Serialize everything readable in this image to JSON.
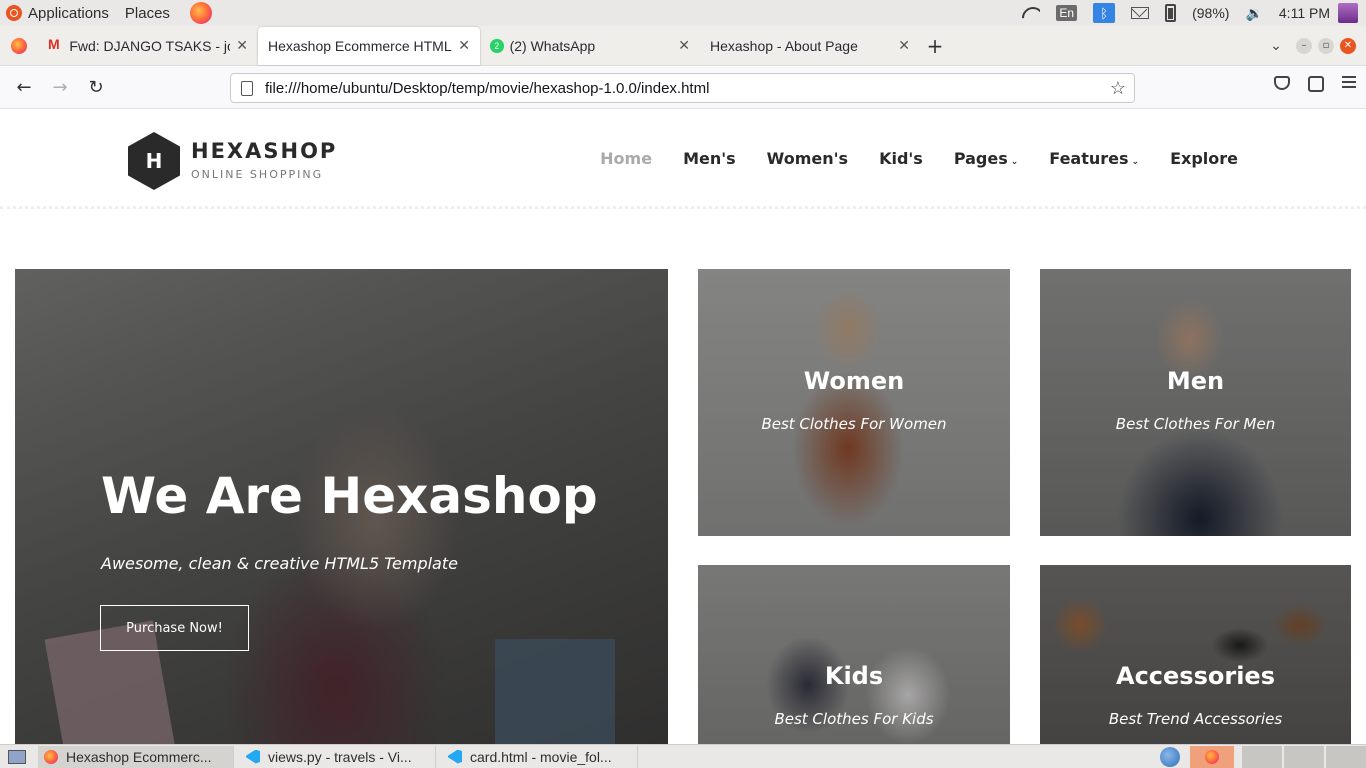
{
  "os_panel": {
    "applications_label": "Applications",
    "places_label": "Places",
    "lang": "En",
    "battery": "(98%)",
    "clock": "4:11 PM"
  },
  "browser": {
    "tabs": [
      {
        "title": "Fwd: DJANGO TSAKS - jo",
        "icon": "gmail-icon"
      },
      {
        "title": "Hexashop Ecommerce HTML",
        "icon": "none",
        "active": true
      },
      {
        "title": "(2) WhatsApp",
        "icon": "whatsapp-icon",
        "badge": "2"
      },
      {
        "title": "Hexashop - About Page",
        "icon": "none"
      }
    ],
    "url": "file:///home/ubuntu/Desktop/temp/movie/hexashop-1.0.0/index.html"
  },
  "site": {
    "logo_letter": "H",
    "logo_name": "HEXASHOP",
    "logo_tagline": "ONLINE SHOPPING",
    "nav": [
      "Home",
      "Men's",
      "Women's",
      "Kid's",
      "Pages",
      "Features",
      "Explore"
    ],
    "hero": {
      "title": "We Are Hexashop",
      "subtitle": "Awesome, clean & creative HTML5 Template",
      "button": "Purchase Now!"
    },
    "categories": [
      {
        "title": "Women",
        "subtitle": "Best Clothes For Women"
      },
      {
        "title": "Men",
        "subtitle": "Best Clothes For Men"
      },
      {
        "title": "Kids",
        "subtitle": "Best Clothes For Kids"
      },
      {
        "title": "Accessories",
        "subtitle": "Best Trend Accessories"
      }
    ]
  },
  "taskbar": {
    "tasks": [
      {
        "title": "Hexashop Ecommerc...",
        "icon": "firefox-icon"
      },
      {
        "title": "views.py - travels - Vi...",
        "icon": "vscode-icon"
      },
      {
        "title": "card.html - movie_fol...",
        "icon": "vscode-icon"
      }
    ]
  },
  "colors": {
    "accent_ubuntu": "#e95420",
    "logo_dark": "#2a2a2a",
    "nav_active": "#aaaaaa"
  }
}
